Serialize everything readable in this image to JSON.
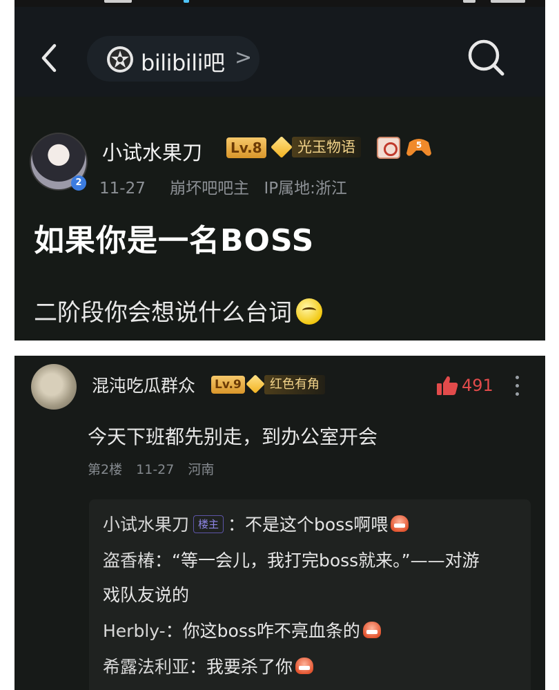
{
  "colors": {
    "background": "#161a17",
    "accent_gold": "#f6c86a",
    "like_red": "#e24b4b",
    "op_tag": "#8f86e6"
  },
  "header": {
    "back_icon": "chevron-left-icon",
    "forum_name": "bilibili吧",
    "forum_chevron": ">",
    "search_icon": "search-icon"
  },
  "post": {
    "author": "小试水果刀",
    "level": "Lv.8",
    "title_badge": "光玉物语",
    "avatar_badge": "2",
    "date": "11-27",
    "role": "崩坏吧吧主",
    "ip": "IP属地:浙江",
    "title": "如果你是一名BOSS",
    "body": "二阶段你会想说什么台词"
  },
  "comment": {
    "author": "混沌吃瓜群众",
    "level": "Lv.9",
    "title_badge": "红色有角",
    "likes": "491",
    "text": "今天下班都先别走，到办公室开会",
    "floor": "第2楼",
    "date": "11-27",
    "location": "河南"
  },
  "replies": [
    {
      "name": "小试水果刀",
      "tag": "楼主",
      "text": "：不是这个boss啊喂"
    },
    {
      "name": "盗香椿",
      "text": "：“等一会儿，我打完boss就来。”——对游"
    },
    {
      "name": "",
      "text": "戏队友说的"
    },
    {
      "name": "Herbly-",
      "text": "：你这boss咋不亮血条的"
    },
    {
      "name": "希露法利亚",
      "text": "：我要杀了你"
    }
  ]
}
